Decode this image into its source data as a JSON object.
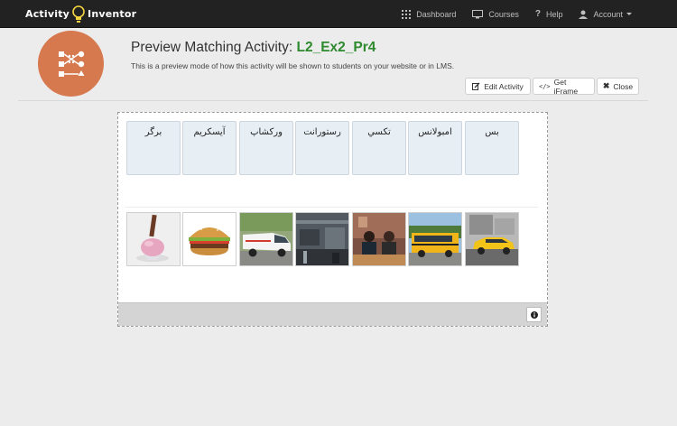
{
  "navbar": {
    "brand_left": "Activity",
    "brand_right": "Inventor",
    "items": [
      {
        "label": "Dashboard",
        "icon": "dashboard-icon"
      },
      {
        "label": "Courses",
        "icon": "monitor-icon"
      },
      {
        "label": "Help",
        "icon": "question-icon"
      },
      {
        "label": "Account",
        "icon": "user-icon"
      }
    ]
  },
  "header": {
    "title_prefix": "Preview Matching Activity: ",
    "activity_name": "L2_Ex2_Pr4",
    "subtitle": "This is a preview mode of how this activity will be shown to students on your website or in LMS.",
    "buttons": {
      "edit": "Edit Activity",
      "iframe": "Get iFrame",
      "close": "Close"
    }
  },
  "activity": {
    "words": [
      "برگر",
      "آیسکریم",
      "ورکشاپ",
      "رستورانت",
      "تکسي",
      "امبولانس",
      "بس"
    ],
    "images": [
      "ice-cream",
      "burger",
      "ambulance",
      "workshop",
      "restaurant",
      "school-bus",
      "taxi"
    ]
  },
  "colors": {
    "navbar": "#222222",
    "accent_green": "#2e8a2e",
    "logo_orange": "#d6794e",
    "card_bg": "#e7eef4"
  }
}
